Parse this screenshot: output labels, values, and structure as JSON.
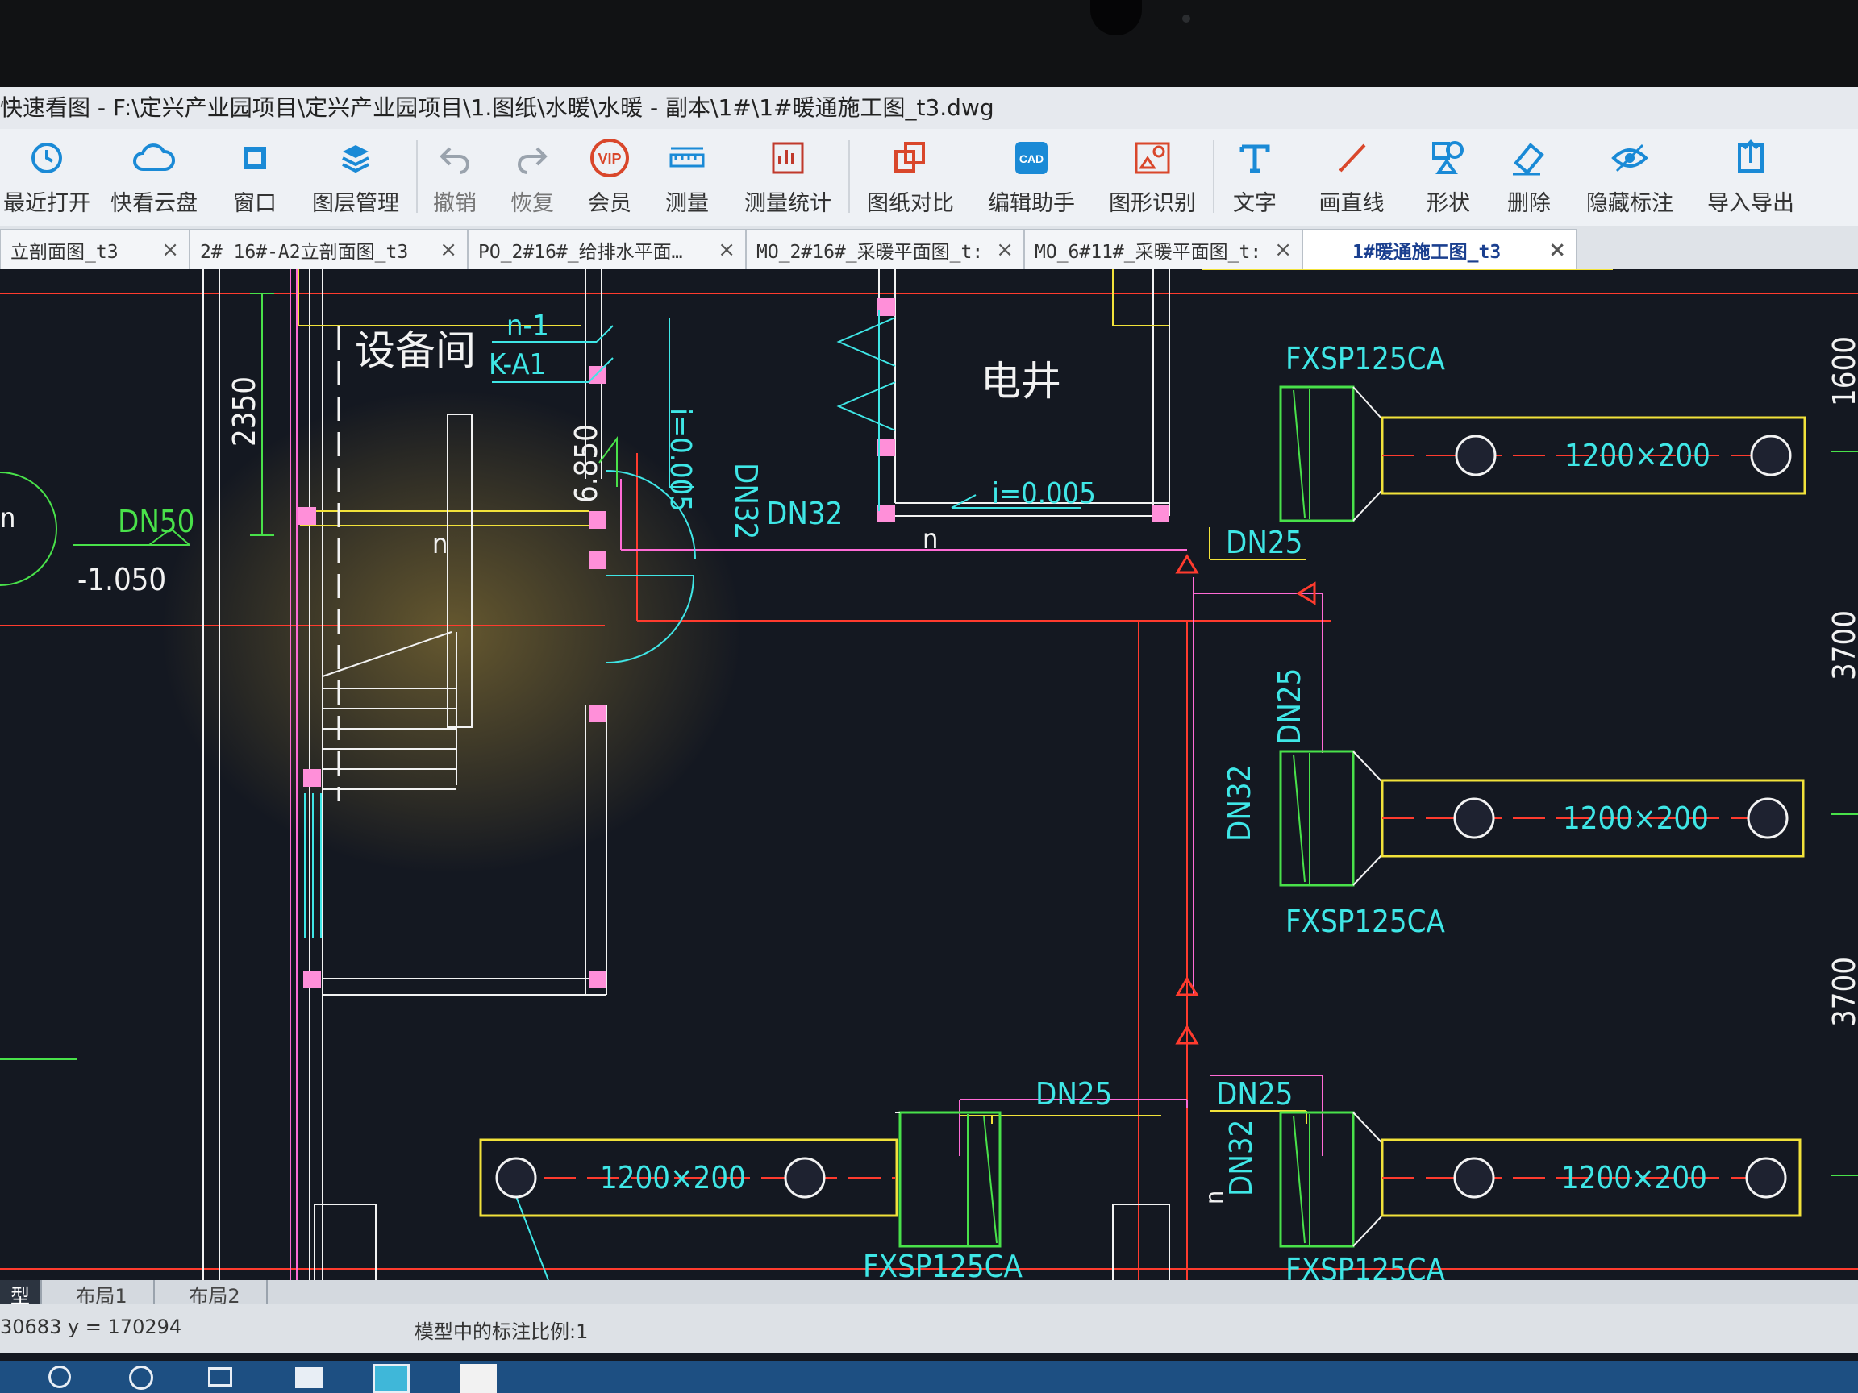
{
  "window": {
    "title": "快速看图 - F:\\定兴产业园项目\\定兴产业园项目\\1.图纸\\水暖\\水暖 - 副本\\1#\\1#暖通施工图_t3.dwg"
  },
  "toolbar": {
    "items": [
      {
        "label": "最近打开",
        "icon": "clock-icon",
        "color": "#1a8ad6"
      },
      {
        "label": "快看云盘",
        "icon": "cloud-icon",
        "color": "#1a8ad6"
      },
      {
        "label": "窗口",
        "icon": "window-icon",
        "color": "#1a8ad6"
      },
      {
        "label": "图层管理",
        "icon": "layers-icon",
        "color": "#1a8ad6"
      },
      {
        "label": "撤销",
        "icon": "undo-icon",
        "color": "#9aa3ad"
      },
      {
        "label": "恢复",
        "icon": "redo-icon",
        "color": "#9aa3ad"
      },
      {
        "label": "会员",
        "icon": "vip-icon",
        "color": "#d9472b"
      },
      {
        "label": "测量",
        "icon": "ruler-icon",
        "color": "#1a8ad6"
      },
      {
        "label": "测量统计",
        "icon": "measure-stats-icon",
        "color": "#c0392b"
      },
      {
        "label": "图纸对比",
        "icon": "compare-icon",
        "color": "#d9472b"
      },
      {
        "label": "编辑助手",
        "icon": "edit-assistant-icon",
        "color": "#1a8ad6"
      },
      {
        "label": "图形识别",
        "icon": "shape-recognize-icon",
        "color": "#d9472b"
      },
      {
        "label": "文字",
        "icon": "text-icon",
        "color": "#1a8ad6"
      },
      {
        "label": "画直线",
        "icon": "line-icon",
        "color": "#d9472b"
      },
      {
        "label": "形状",
        "icon": "shape-icon",
        "color": "#1a8ad6"
      },
      {
        "label": "删除",
        "icon": "eraser-icon",
        "color": "#1a8ad6"
      },
      {
        "label": "隐藏标注",
        "icon": "eye-icon",
        "color": "#1a8ad6"
      },
      {
        "label": "导入导出",
        "icon": "export-icon",
        "color": "#1a8ad6"
      }
    ]
  },
  "tabs": [
    {
      "label": "立剖面图_t3",
      "active": false
    },
    {
      "label": "2# 16#-A2立剖面图_t3",
      "active": false
    },
    {
      "label": "PO_2#16#_给排水平面…",
      "active": false
    },
    {
      "label": "MO_2#16#_采暖平面图_t:",
      "active": false
    },
    {
      "label": "MO_6#11#_采暖平面图_t:",
      "active": false
    },
    {
      "label": "1#暖通施工图_t3",
      "active": true
    }
  ],
  "drawing": {
    "room_equipment": "设备间",
    "room_shaft": "电井",
    "dim_2350": "2350",
    "dim_1600": "1600",
    "dim_3700a": "3700",
    "dim_3700b": "3700",
    "elev_neg": "-1.050",
    "elev_6850": "6.850",
    "pipe_dn50": "DN50",
    "pipe_dn32_a": "DN32",
    "pipe_dn32_b": "DN32",
    "pipe_dn32_c": "DN32",
    "pipe_dn32_d": "DN32",
    "pipe_dn25_a": "DN25",
    "pipe_dn25_b": "DN25",
    "pipe_dn25_c": "DN25",
    "pipe_dn25_d": "DN25",
    "slope_a": "i=0.005",
    "slope_b": "i=0.005",
    "label_n1": "n-1",
    "label_ka1": "K-A1",
    "label_n_a": "n",
    "label_n_b": "n",
    "label_n_c": "n",
    "label_n_d": "n",
    "unit_1": "FXSP125CA",
    "unit_2": "FXSP125CA",
    "unit_3": "FXSP125CA",
    "unit_4": "FXSP125CA",
    "duct_1": "1200×200",
    "duct_2": "1200×200",
    "duct_3": "1200×200",
    "duct_4": "1200×200"
  },
  "layout_tabs": [
    {
      "label": "型",
      "active": true
    },
    {
      "label": "布局1",
      "active": false
    },
    {
      "label": "布局2",
      "active": false
    }
  ],
  "status": {
    "coords": "30683  y = 170294",
    "scale": "模型中的标注比例:1"
  },
  "colors": {
    "cad_background": "#141821",
    "red": "#ff3b2e",
    "yellow": "#f2e23a",
    "green": "#49e14a",
    "cyan": "#3fe6e6",
    "magenta": "#ff6bd6",
    "white": "#f2f2f2"
  }
}
